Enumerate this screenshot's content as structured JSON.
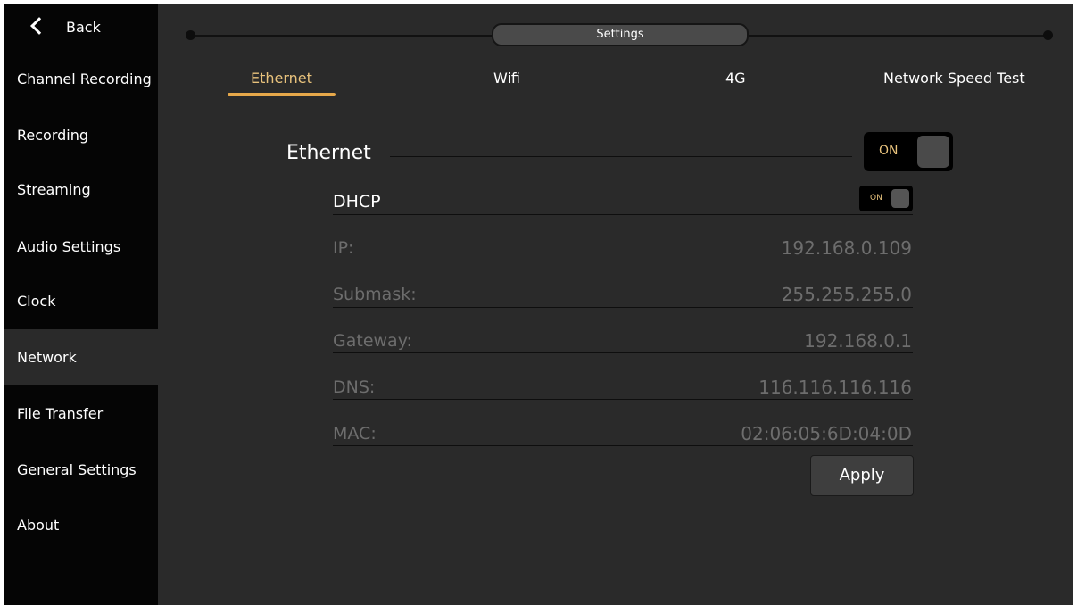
{
  "sidebar": {
    "back_label": "Back",
    "items": [
      {
        "label": "Channel Recording"
      },
      {
        "label": "Recording"
      },
      {
        "label": "Streaming"
      },
      {
        "label": "Audio Settings"
      },
      {
        "label": "Clock"
      },
      {
        "label": "Network",
        "active": true
      },
      {
        "label": "File Transfer"
      },
      {
        "label": "General Settings"
      },
      {
        "label": "About"
      }
    ]
  },
  "header": {
    "title": "Settings"
  },
  "tabs": [
    {
      "label": "Ethernet",
      "active": true
    },
    {
      "label": "Wifi"
    },
    {
      "label": "4G"
    },
    {
      "label": "Network Speed Test"
    }
  ],
  "ethernet": {
    "title": "Ethernet",
    "toggle_label": "ON",
    "dhcp": {
      "label": "DHCP",
      "toggle_label": "ON"
    },
    "fields": {
      "ip": {
        "label": "IP:",
        "value": "192.168.0.109"
      },
      "submask": {
        "label": "Submask:",
        "value": "255.255.255.0"
      },
      "gateway": {
        "label": "Gateway:",
        "value": "192.168.0.1"
      },
      "dns": {
        "label": "DNS:",
        "value": "116.116.116.116"
      },
      "mac": {
        "label": "MAC:",
        "value": "02:06:05:6D:04:0D"
      }
    },
    "apply_label": "Apply"
  },
  "colors": {
    "background": "#2a2a2a",
    "sidebar": "#050505",
    "accent": "#e6a84a",
    "muted_text": "#6d6d6d"
  }
}
